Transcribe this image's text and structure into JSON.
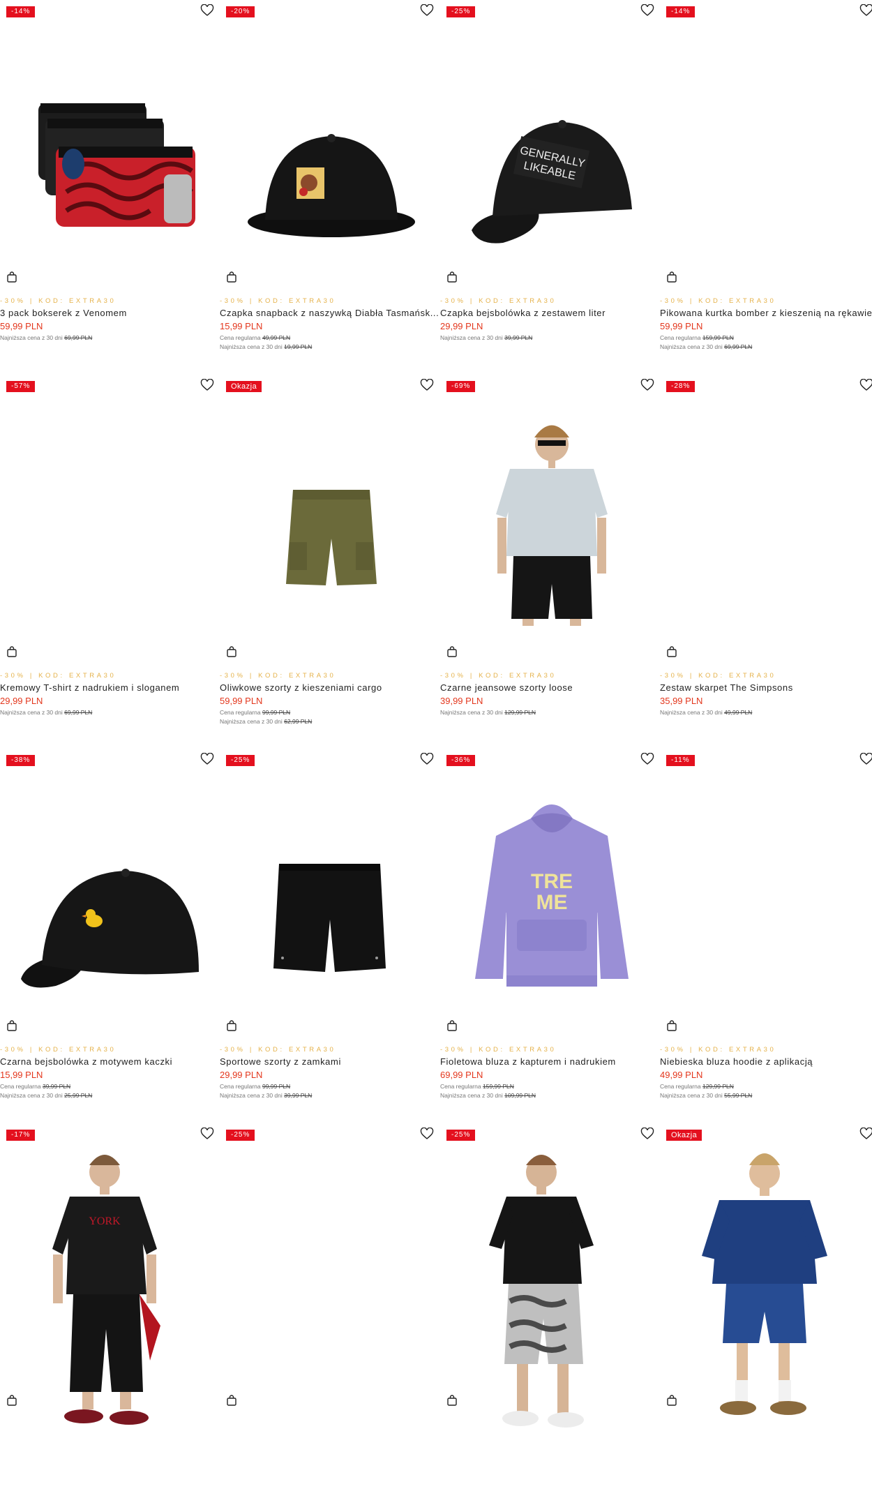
{
  "colors": {
    "badge": "#e4101e",
    "price": "#e3361c",
    "promo": "#e5b24a"
  },
  "labels": {
    "regular": "Cena regularna",
    "lowest30": "Najniższa cena z 30 dni"
  },
  "products": [
    {
      "badge": "-14%",
      "promo": "-30% | KOD: EXTRA30",
      "title": "3 pack bokserek z Venomem",
      "price": "59,99 PLN",
      "regular": "",
      "lowest": "69,99 PLN",
      "image": "boxer-briefs-venom"
    },
    {
      "badge": "-20%",
      "promo": "-30% | KOD: EXTRA30",
      "title": "Czapka snapback z naszywką Diabła Tasmańsk...",
      "price": "15,99 PLN",
      "regular": "49,99 PLN",
      "lowest": "19,99 PLN",
      "image": "snapback-cap"
    },
    {
      "badge": "-25%",
      "promo": "-30% | KOD: EXTRA30",
      "title": "Czapka bejsbolówka z zestawem liter",
      "price": "29,99 PLN",
      "regular": "",
      "lowest": "39,99 PLN",
      "image": "baseball-cap-letters"
    },
    {
      "badge": "-14%",
      "promo": "-30% | KOD: EXTRA30",
      "title": "Pikowana kurtka bomber z kieszenią na rękawie",
      "price": "59,99 PLN",
      "regular": "159,99 PLN",
      "lowest": "69,99 PLN",
      "image": "bomber-jacket"
    },
    {
      "badge": "-57%",
      "promo": "-30% | KOD: EXTRA30",
      "title": "Kremowy T-shirt z nadrukiem i sloganem",
      "price": "29,99 PLN",
      "regular": "",
      "lowest": "69,99 PLN",
      "image": "cream-tshirt"
    },
    {
      "badge": "Okazja",
      "promo": "-30% | KOD: EXTRA30",
      "title": "Oliwkowe szorty z kieszeniami cargo",
      "price": "59,99 PLN",
      "regular": "99,99 PLN",
      "lowest": "62,99 PLN",
      "image": "olive-cargo-shorts"
    },
    {
      "badge": "-69%",
      "promo": "-30% | KOD: EXTRA30",
      "title": "Czarne jeansowe szorty loose",
      "price": "39,99 PLN",
      "regular": "",
      "lowest": "129,99 PLN",
      "image": "model-black-shorts"
    },
    {
      "badge": "-28%",
      "promo": "-30% | KOD: EXTRA30",
      "title": "Zestaw skarpet The Simpsons",
      "price": "35,99 PLN",
      "regular": "",
      "lowest": "49,99 PLN",
      "image": "socks-set"
    },
    {
      "badge": "-38%",
      "promo": "-30% | KOD: EXTRA30",
      "title": "Czarna bejsbolówka z motywem kaczki",
      "price": "15,99 PLN",
      "regular": "39,99 PLN",
      "lowest": "25,99 PLN",
      "image": "duck-cap"
    },
    {
      "badge": "-25%",
      "promo": "-30% | KOD: EXTRA30",
      "title": "Sportowe szorty z zamkami",
      "price": "29,99 PLN",
      "regular": "99,99 PLN",
      "lowest": "39,99 PLN",
      "image": "black-sport-shorts"
    },
    {
      "badge": "-36%",
      "promo": "-30% | KOD: EXTRA30",
      "title": "Fioletowa bluza z kapturem i nadrukiem",
      "price": "69,99 PLN",
      "regular": "159,99 PLN",
      "lowest": "109,99 PLN",
      "image": "purple-hoodie"
    },
    {
      "badge": "-11%",
      "promo": "-30% | KOD: EXTRA30",
      "title": "Niebieska bluza hoodie z aplikacją",
      "price": "49,99 PLN",
      "regular": "129,99 PLN",
      "lowest": "55,99 PLN",
      "image": "blue-hoodie"
    },
    {
      "badge": "-17%",
      "promo": "",
      "title": "",
      "price": "",
      "regular": "",
      "lowest": "",
      "image": "model-jersey"
    },
    {
      "badge": "-25%",
      "promo": "",
      "title": "",
      "price": "",
      "regular": "",
      "lowest": "",
      "image": "blank"
    },
    {
      "badge": "-25%",
      "promo": "",
      "title": "",
      "price": "",
      "regular": "",
      "lowest": "",
      "image": "model-camo-shorts"
    },
    {
      "badge": "Okazja",
      "promo": "",
      "title": "",
      "price": "",
      "regular": "",
      "lowest": "",
      "image": "model-navy-set"
    }
  ]
}
